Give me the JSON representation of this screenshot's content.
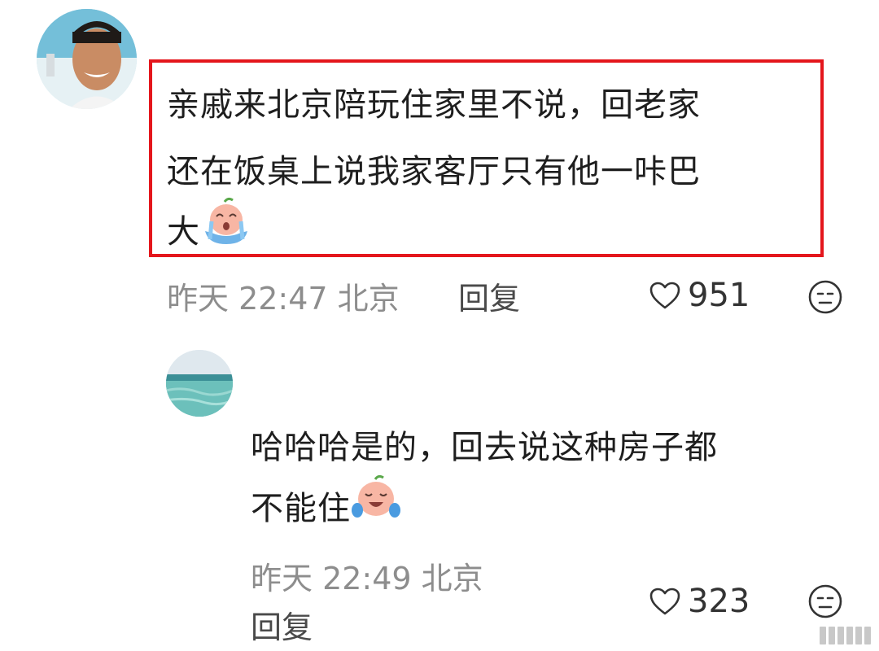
{
  "comments": [
    {
      "text_line1": "亲戚来北京陪玩住家里不说，回老家",
      "text_line2": "还在饭桌上说我家客厅只有他一咔巴",
      "text_line3": "大",
      "emoji": "crying-face-emoji",
      "time": "昨天 22:47 北京",
      "reply_label": "回复",
      "likes": "951",
      "highlight_color": "#e4161c"
    },
    {
      "text_line1": "哈哈哈是的，回去说这种房子都",
      "text_line2": "不能住",
      "emoji": "laughing-tears-emoji",
      "time": "昨天 22:49 北京",
      "reply_label": "回复",
      "likes": "323"
    }
  ],
  "icons": {
    "like": "heart-outline-icon",
    "dislike": "neutral-face-icon"
  }
}
